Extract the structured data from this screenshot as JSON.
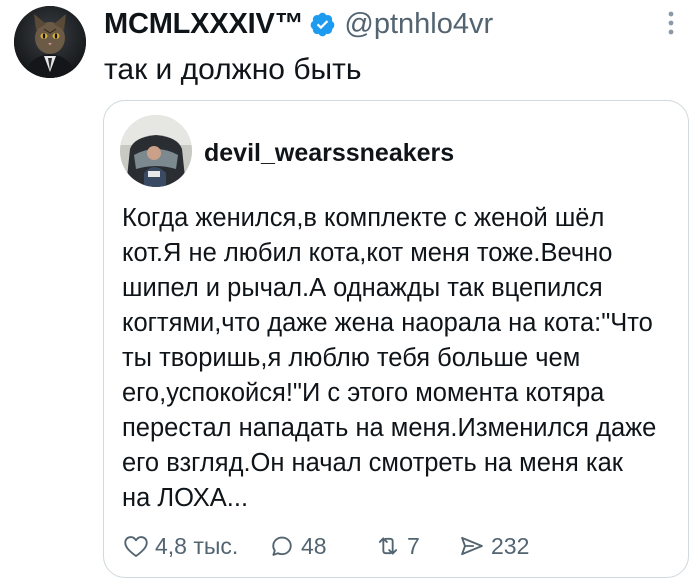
{
  "post": {
    "display_name": "MCMLXXXIV™",
    "handle": "@ptnhlo4vr",
    "text": "так и должно быть",
    "verified_icon": "verified-badge-icon",
    "more_icon": "more-vertical-icon",
    "accent_color": "#1d9bf0"
  },
  "quote": {
    "username": "devil_wearssneakers",
    "lines": [
      "Когда женился,в комплекте с женой шёл",
      "кот.Я не любил кота,кот меня тоже.Вечно",
      "шипел и рычал.А однажды так вцепился",
      "когтями,что даже жена наорала на кота:\"Что",
      "ты творишь,я люблю тебя больше чем",
      "его,успокойся!\"И с этого момента котяра",
      "перестал нападать на меня.Изменился даже",
      "его взгляд.Он начал смотреть на меня как",
      "на ЛОХА..."
    ],
    "actions": {
      "likes": "4,8 тыс.",
      "replies": "48",
      "reposts": "7",
      "shares": "232"
    }
  }
}
